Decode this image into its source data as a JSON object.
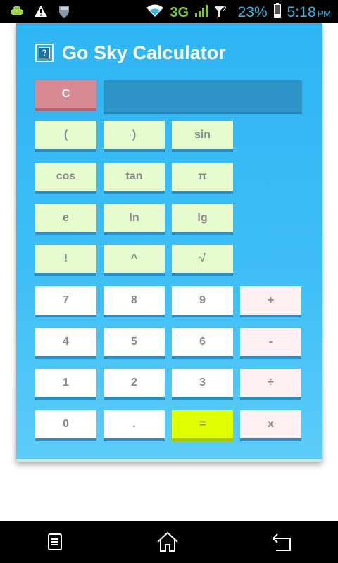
{
  "status_bar": {
    "network": "3G",
    "signal_slot": "2",
    "battery": "23%",
    "time": "5:18",
    "ampm": "PM",
    "icons": [
      "android-debug-icon",
      "warning-icon",
      "shield-icon",
      "wifi-icon",
      "signal-icon",
      "battery-icon"
    ]
  },
  "app": {
    "title": "Go Sky Calculator",
    "help_icon_glyph": "?"
  },
  "display": {
    "value": ""
  },
  "keys": {
    "clear": "C",
    "paren_open": "(",
    "paren_close": ")",
    "sin": "sin",
    "cos": "cos",
    "tan": "tan",
    "pi": "π",
    "e": "e",
    "ln": "ln",
    "lg": "lg",
    "factorial": "!",
    "power": "^",
    "sqrt": "√",
    "seven": "7",
    "eight": "8",
    "nine": "9",
    "plus": "+",
    "four": "4",
    "five": "5",
    "six": "6",
    "minus": "-",
    "one": "1",
    "two": "2",
    "three": "3",
    "divide": "÷",
    "zero": "0",
    "dot": ".",
    "equals": "=",
    "multiply": "x"
  },
  "colors": {
    "card": "#2fb5f4",
    "function_key": "#e6fbce",
    "digit_key": "#ffffff",
    "operator_key": "#fff0f3",
    "clear_key": "#d88a94",
    "equals_key": "#e0ff00",
    "display": "#2e93c7"
  },
  "nav_bar": {
    "icons": [
      "menu-icon",
      "home-icon",
      "back-icon"
    ]
  }
}
